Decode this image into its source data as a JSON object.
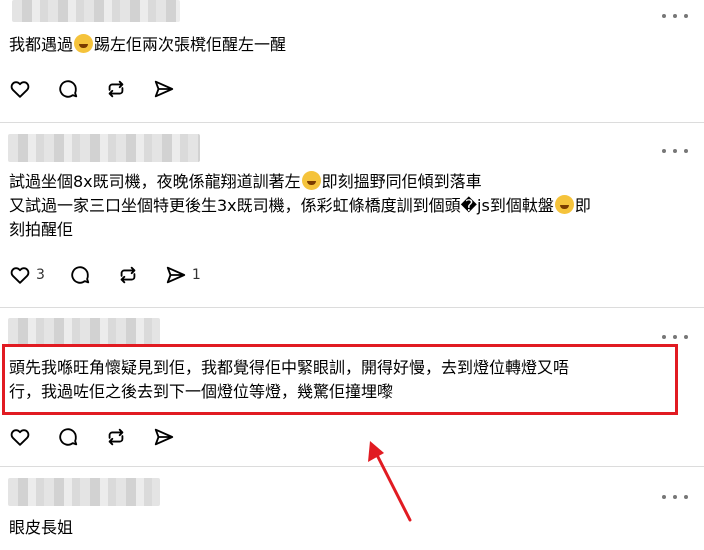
{
  "posts": [
    {
      "lines": [
        [
          "我都遇過",
          "emoji",
          "踢左佢兩次張櫈佢醒左一醒"
        ]
      ],
      "likes": "",
      "reposts": ""
    },
    {
      "lines": [
        [
          "試過坐個8x既司機，夜晚係龍翔道訓著左",
          "emoji",
          "即刻搵野同佢傾到落車"
        ],
        [
          "又試過一家三口坐個特更後生3x既司機，係彩虹條橋度訓到個頭�js到個軚盤",
          "emoji",
          "即"
        ],
        [
          "刻拍醒佢"
        ]
      ],
      "likes": "3",
      "reposts": "1"
    },
    {
      "lines": [
        [
          "頭先我喺旺角懷疑見到佢，我都覺得佢中緊眼訓，開得好慢，去到燈位轉燈又唔"
        ],
        [
          "行，我過咗佢之後去到下一個燈位等燈，幾驚佢撞埋嚟"
        ]
      ],
      "likes": "",
      "reposts": ""
    },
    {
      "lines": [
        [
          "眼皮長姐"
        ]
      ],
      "likes": "",
      "reposts": ""
    }
  ],
  "icons": [
    "heart-icon",
    "comment-icon",
    "repost-icon",
    "share-icon",
    "more-icon"
  ],
  "colors": {
    "highlight": "#e11b22",
    "arrow": "#e11b22",
    "divider": "#dcdcdc"
  }
}
